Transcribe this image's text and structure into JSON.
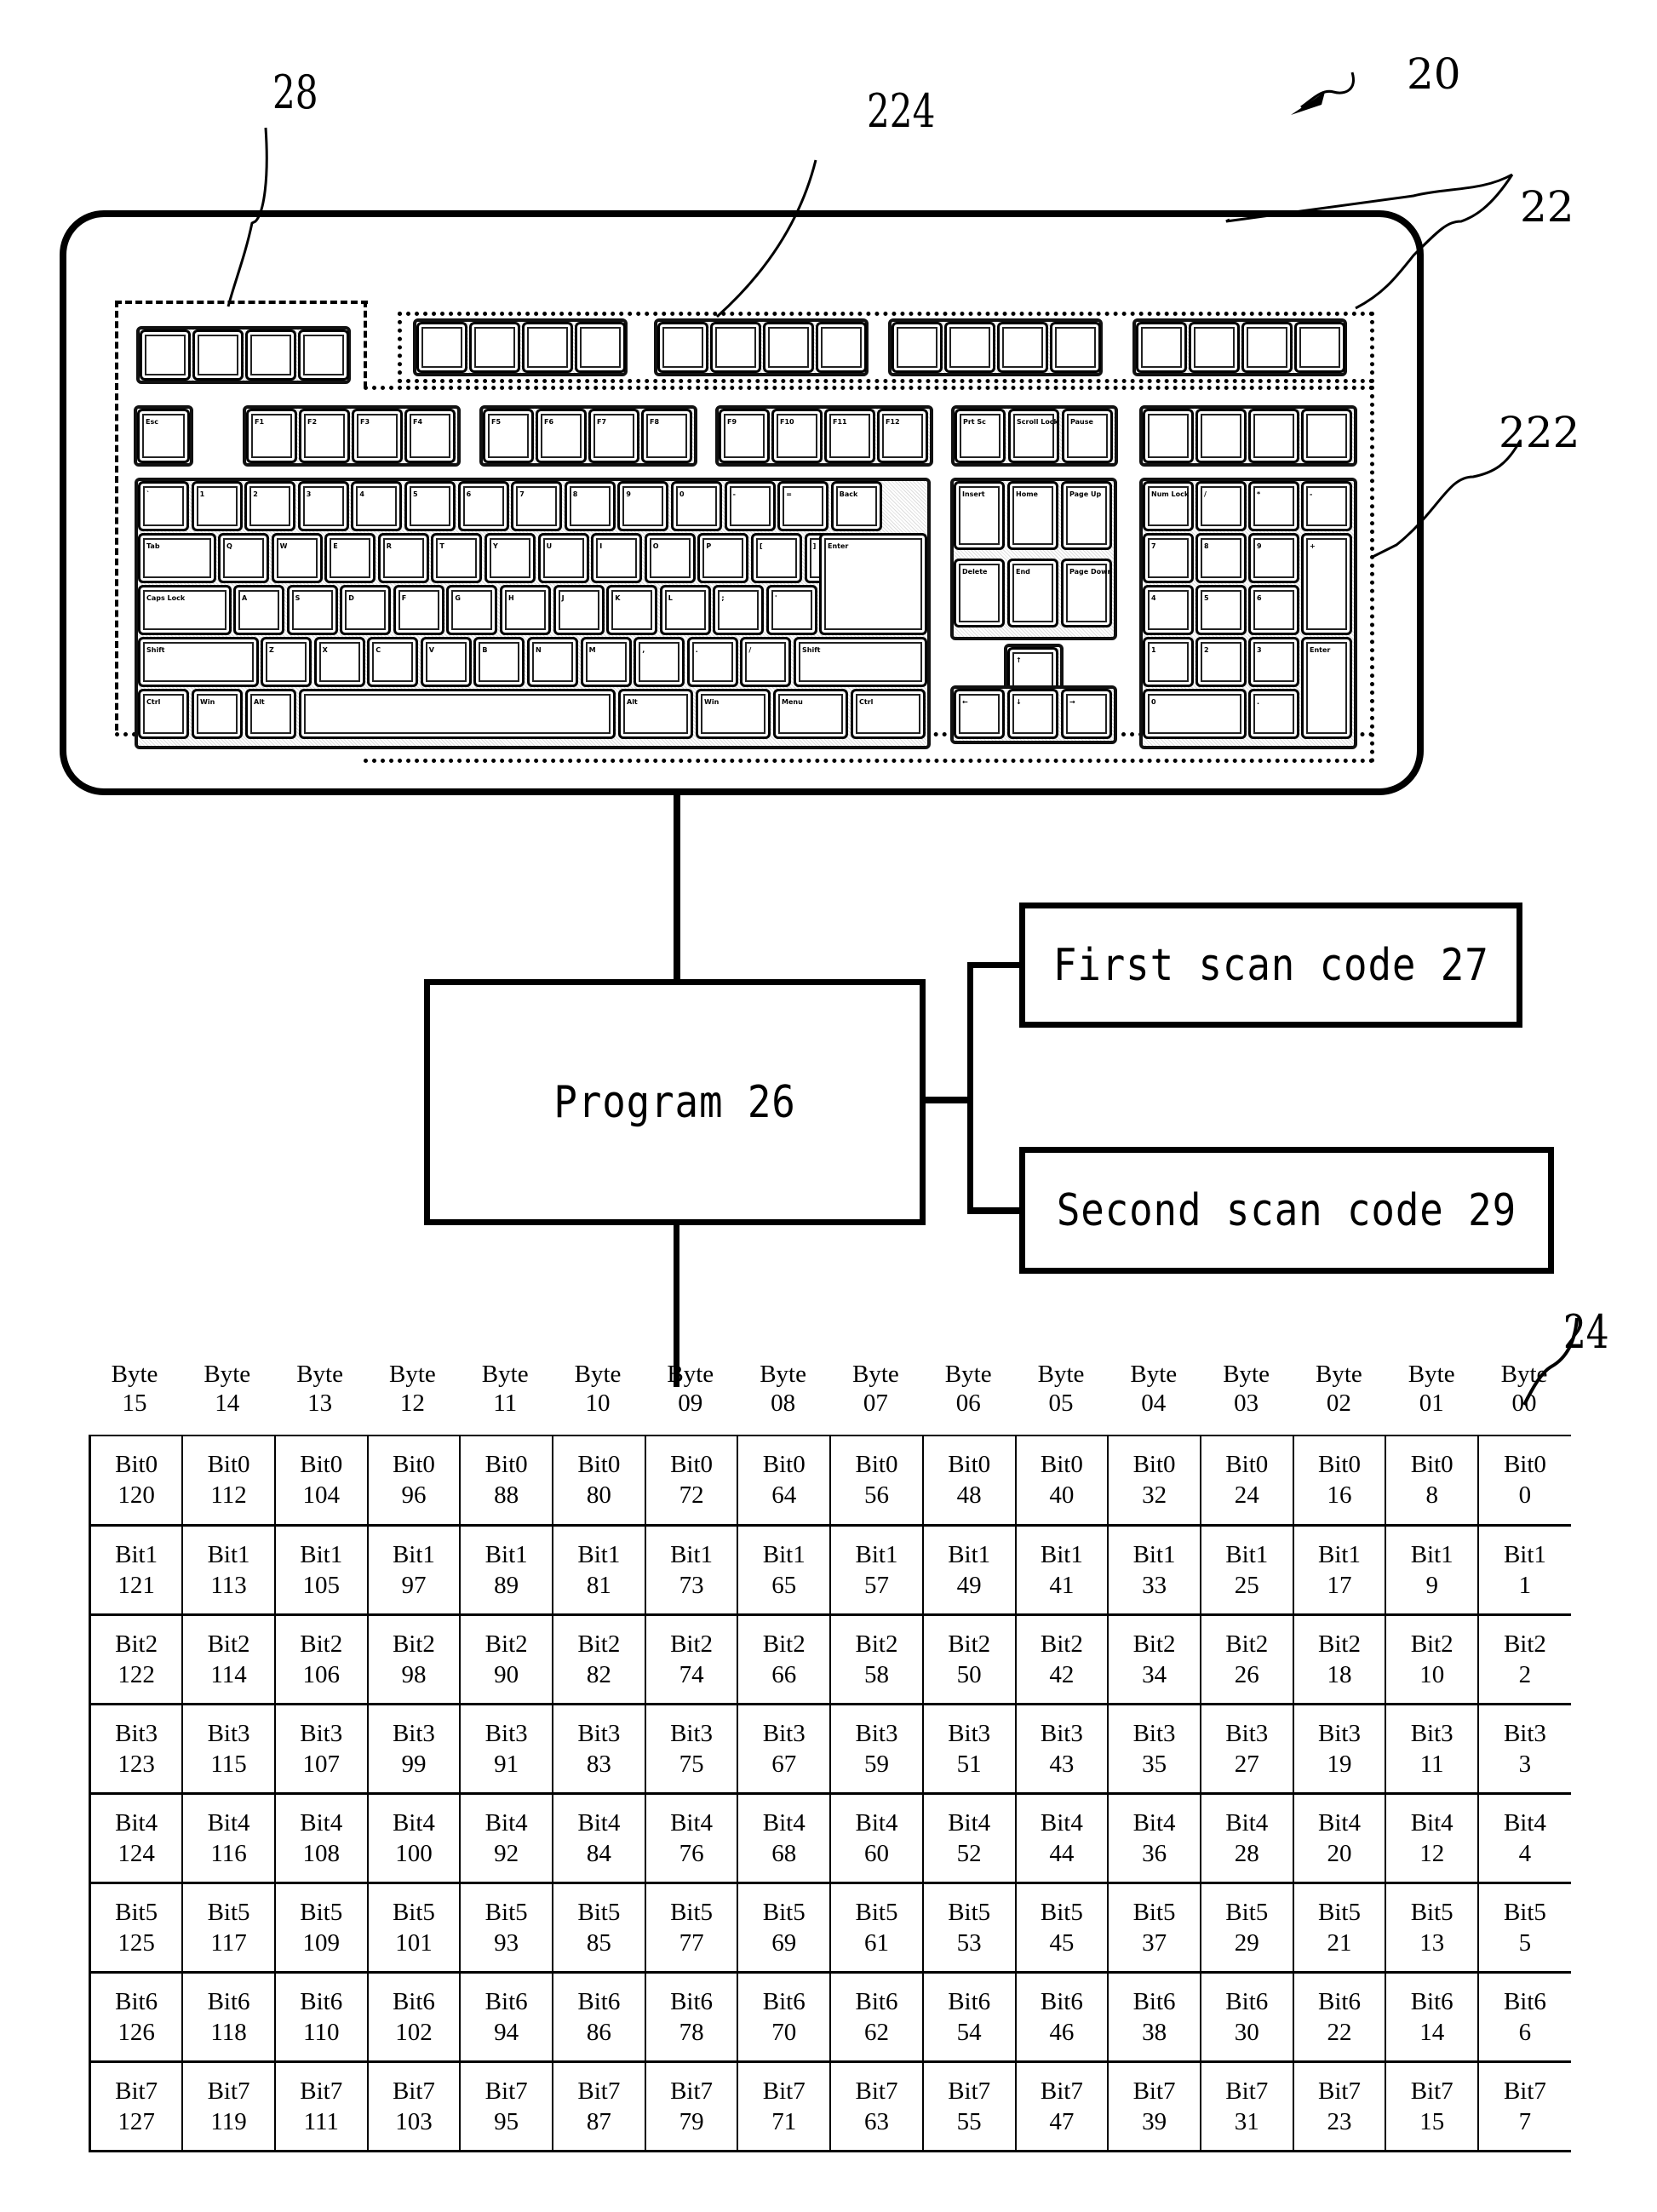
{
  "figure": {
    "reference_labels": {
      "keyboard_device": "20",
      "key_area": "22",
      "main_keys": "222",
      "top_key_row": "224",
      "extra_keys": "28",
      "bitmap_table": "24"
    },
    "program_box": "Program 26",
    "first_scan_code_box": "First scan code 27",
    "second_scan_code_box": "Second scan code 29"
  },
  "keyboard": {
    "extra_keys_28": [
      "",
      "",
      "",
      ""
    ],
    "top_row_224": [
      "",
      "",
      "",
      "",
      "",
      "",
      "",
      "",
      "",
      "",
      "",
      "",
      "",
      "",
      "",
      ""
    ],
    "function_row": [
      "Esc",
      "F1",
      "F2",
      "F3",
      "F4",
      "F5",
      "F6",
      "F7",
      "F8",
      "F9",
      "F10",
      "F11",
      "F12",
      "Prt Sc",
      "Scroll Lock",
      "Pause",
      "",
      "",
      "",
      ""
    ],
    "number_row": [
      "`",
      "1",
      "2",
      "3",
      "4",
      "5",
      "6",
      "7",
      "8",
      "9",
      "0",
      "-",
      "=",
      "Back"
    ],
    "tab_row": [
      "Tab",
      "Q",
      "W",
      "E",
      "R",
      "T",
      "Y",
      "U",
      "I",
      "O",
      "P",
      "[",
      "]"
    ],
    "caps_row": [
      "Caps Lock",
      "A",
      "S",
      "D",
      "F",
      "G",
      "H",
      "J",
      "K",
      "L",
      ";",
      "'",
      "Enter"
    ],
    "shift_row": [
      "Shift",
      "Z",
      "X",
      "C",
      "V",
      "B",
      "N",
      "M",
      ",",
      ".",
      "/",
      "Shift"
    ],
    "bottom_row": [
      "Ctrl",
      "Win",
      "Alt",
      "",
      "Alt",
      "Win",
      "Menu",
      "Ctrl"
    ],
    "nav_cluster": [
      "Insert",
      "Home",
      "Page Up",
      "Delete",
      "End",
      "Page Down",
      "↑",
      "←",
      "↓",
      "→"
    ],
    "numpad": [
      "Num Lock",
      "/",
      "*",
      "-",
      "7",
      "8",
      "9",
      "+",
      "4",
      "5",
      "6",
      "1",
      "2",
      "3",
      "Enter",
      "0",
      "."
    ]
  },
  "bitmap": {
    "byte_headers": [
      {
        "word": "Byte",
        "num": "15"
      },
      {
        "word": "Byte",
        "num": "14"
      },
      {
        "word": "Byte",
        "num": "13"
      },
      {
        "word": "Byte",
        "num": "12"
      },
      {
        "word": "Byte",
        "num": "11"
      },
      {
        "word": "Byte",
        "num": "10"
      },
      {
        "word": "Byte",
        "num": "09"
      },
      {
        "word": "Byte",
        "num": "08"
      },
      {
        "word": "Byte",
        "num": "07"
      },
      {
        "word": "Byte",
        "num": "06"
      },
      {
        "word": "Byte",
        "num": "05"
      },
      {
        "word": "Byte",
        "num": "04"
      },
      {
        "word": "Byte",
        "num": "03"
      },
      {
        "word": "Byte",
        "num": "02"
      },
      {
        "word": "Byte",
        "num": "01"
      },
      {
        "word": "Byte",
        "num": "00"
      }
    ],
    "rows": [
      {
        "bit": "Bit0",
        "values": [
          "120",
          "112",
          "104",
          "96",
          "88",
          "80",
          "72",
          "64",
          "56",
          "48",
          "40",
          "32",
          "24",
          "16",
          "8",
          "0"
        ]
      },
      {
        "bit": "Bit1",
        "values": [
          "121",
          "113",
          "105",
          "97",
          "89",
          "81",
          "73",
          "65",
          "57",
          "49",
          "41",
          "33",
          "25",
          "17",
          "9",
          "1"
        ]
      },
      {
        "bit": "Bit2",
        "values": [
          "122",
          "114",
          "106",
          "98",
          "90",
          "82",
          "74",
          "66",
          "58",
          "50",
          "42",
          "34",
          "26",
          "18",
          "10",
          "2"
        ]
      },
      {
        "bit": "Bit3",
        "values": [
          "123",
          "115",
          "107",
          "99",
          "91",
          "83",
          "75",
          "67",
          "59",
          "51",
          "43",
          "35",
          "27",
          "19",
          "11",
          "3"
        ]
      },
      {
        "bit": "Bit4",
        "values": [
          "124",
          "116",
          "108",
          "100",
          "92",
          "84",
          "76",
          "68",
          "60",
          "52",
          "44",
          "36",
          "28",
          "20",
          "12",
          "4"
        ]
      },
      {
        "bit": "Bit5",
        "values": [
          "125",
          "117",
          "109",
          "101",
          "93",
          "85",
          "77",
          "69",
          "61",
          "53",
          "45",
          "37",
          "29",
          "21",
          "13",
          "5"
        ]
      },
      {
        "bit": "Bit6",
        "values": [
          "126",
          "118",
          "110",
          "102",
          "94",
          "86",
          "78",
          "70",
          "62",
          "54",
          "46",
          "38",
          "30",
          "22",
          "14",
          "6"
        ]
      },
      {
        "bit": "Bit7",
        "values": [
          "127",
          "119",
          "111",
          "103",
          "95",
          "87",
          "79",
          "71",
          "63",
          "55",
          "47",
          "39",
          "31",
          "23",
          "15",
          "7"
        ]
      }
    ]
  }
}
